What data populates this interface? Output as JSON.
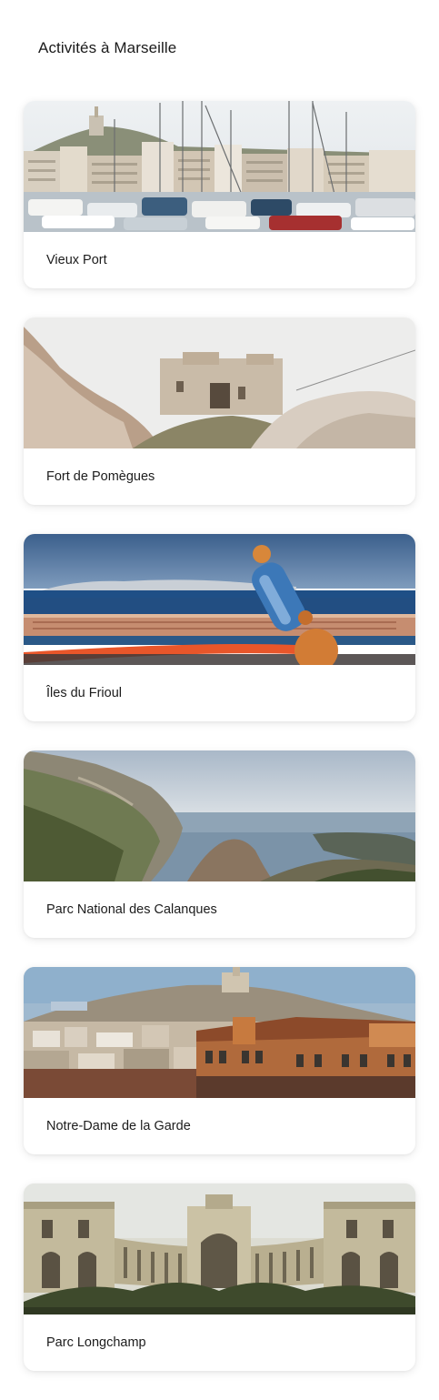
{
  "page": {
    "title": "Activités à Marseille"
  },
  "activities": [
    {
      "label": "Vieux Port"
    },
    {
      "label": "Fort de Pomègues"
    },
    {
      "label": "Îles du Frioul"
    },
    {
      "label": "Parc National des Calanques"
    },
    {
      "label": "Notre-Dame de la Garde"
    },
    {
      "label": "Parc Longchamp"
    }
  ]
}
